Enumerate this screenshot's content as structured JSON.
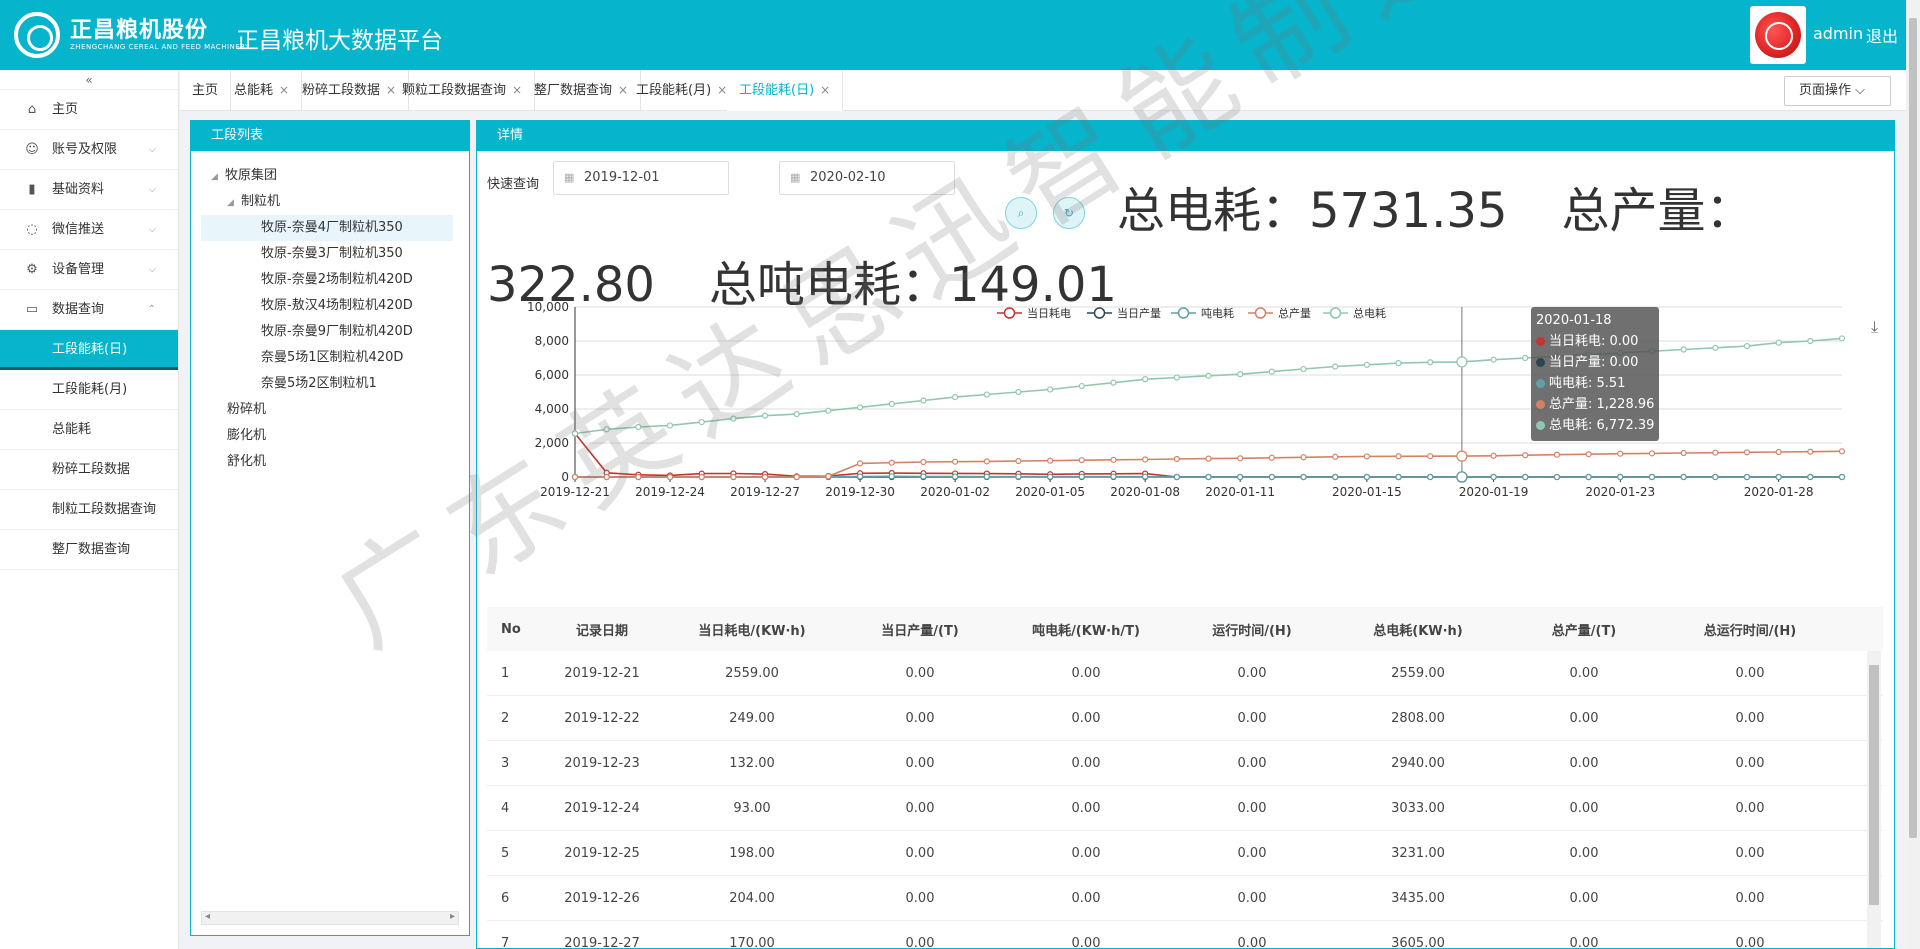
{
  "header": {
    "brand_cn": "正昌粮机股份",
    "brand_en": "ZHENGCHANG CEREAL AND FEED MACHINERY",
    "platform_title": "正昌粮机大数据平台",
    "user": "admin",
    "logout": "退出"
  },
  "sidebar": {
    "collapse": "«",
    "items": [
      {
        "label": "主页",
        "icon": "home-icon",
        "glyph": "⌂"
      },
      {
        "label": "账号及权限",
        "icon": "user-icon",
        "glyph": "☺",
        "chev": "⌵"
      },
      {
        "label": "基础资料",
        "icon": "bar-chart-icon",
        "glyph": "▮",
        "chev": "⌵"
      },
      {
        "label": "微信推送",
        "icon": "wechat-icon",
        "glyph": "◌",
        "chev": "⌵"
      },
      {
        "label": "设备管理",
        "icon": "chip-icon",
        "glyph": "⚙",
        "chev": "⌵"
      },
      {
        "label": "数据查询",
        "icon": "monitor-icon",
        "glyph": "▭",
        "chev": "⌃"
      }
    ],
    "sub_items": [
      "工段能耗(日)",
      "工段能耗(月)",
      "总能耗",
      "粉碎工段数据",
      "制粒工段数据查询",
      "整厂数据查询"
    ]
  },
  "tabs": [
    {
      "label": "主页",
      "closable": false
    },
    {
      "label": "总能耗",
      "closable": true
    },
    {
      "label": "粉碎工段数据",
      "closable": true
    },
    {
      "label": "颗粒工段数据查询",
      "closable": true
    },
    {
      "label": "整厂数据查询",
      "closable": true
    },
    {
      "label": "工段能耗(月)",
      "closable": true
    },
    {
      "label": "工段能耗(日)",
      "closable": true
    }
  ],
  "tab_close": "×",
  "page_ops": "页面操作 ⌵",
  "left_panel": {
    "title": "工段列表",
    "tree": [
      {
        "label": "牧原集团",
        "level": 0,
        "caret": "◢"
      },
      {
        "label": "制粒机",
        "level": 1,
        "caret": "◢"
      },
      {
        "label": "牧原-奈曼4厂制粒机350",
        "level": 2,
        "selected": true
      },
      {
        "label": "牧原-奈曼3厂制粒机350",
        "level": 2
      },
      {
        "label": "牧原-奈曼2场制粒机420D",
        "level": 2
      },
      {
        "label": "牧原-敖汉4场制粒机420D",
        "level": 2
      },
      {
        "label": "牧原-奈曼9厂制粒机420D",
        "level": 2
      },
      {
        "label": "奈曼5场1区制粒机420D",
        "level": 2
      },
      {
        "label": "奈曼5场2区制粒机1",
        "level": 2
      },
      {
        "label": "粉碎机",
        "level": 1
      },
      {
        "label": "膨化机",
        "level": 1
      },
      {
        "label": "舒化机",
        "level": 1
      }
    ],
    "scroll_left": "◂",
    "scroll_right": "▸"
  },
  "detail": {
    "title": "详情",
    "quick_query": "快速查询",
    "date_from": "2019-12-01",
    "date_to": "2020-02-10",
    "summary": {
      "power_label": "总电耗：",
      "power_value": "5731.35",
      "output_label": "总产量：",
      "output_value": "322.80",
      "per_ton_label": "总吨电耗：",
      "per_ton_value": "149.01"
    }
  },
  "tooltip": {
    "date": "2020-01-18",
    "rows": [
      {
        "text": "当日耗电: 0.00",
        "color": "#c23531"
      },
      {
        "text": "当日产量: 0.00",
        "color": "#2f4554"
      },
      {
        "text": "吨电耗: 5.51",
        "color": "#61a0a8"
      },
      {
        "text": "总产量: 1,228.96",
        "color": "#d48265"
      },
      {
        "text": "总电耗: 6,772.39",
        "color": "#91c7ae"
      }
    ]
  },
  "chart_data": {
    "type": "line",
    "x": [
      "2019-12-21",
      "2019-12-22",
      "2019-12-23",
      "2019-12-24",
      "2019-12-25",
      "2019-12-26",
      "2019-12-27",
      "2019-12-28",
      "2019-12-29",
      "2019-12-30",
      "2019-12-31",
      "2020-01-01",
      "2020-01-02",
      "2020-01-03",
      "2020-01-04",
      "2020-01-05",
      "2020-01-06",
      "2020-01-07",
      "2020-01-08",
      "2020-01-09",
      "2020-01-10",
      "2020-01-11",
      "2020-01-12",
      "2020-01-13",
      "2020-01-14",
      "2020-01-15",
      "2020-01-16",
      "2020-01-17",
      "2020-01-18",
      "2020-01-19",
      "2020-01-20",
      "2020-01-21",
      "2020-01-22",
      "2020-01-23",
      "2020-01-24",
      "2020-01-25",
      "2020-01-26",
      "2020-01-27",
      "2020-01-28",
      "2020-01-29",
      "2020-01-30"
    ],
    "x_ticks": [
      "2019-12-21",
      "2019-12-24",
      "2019-12-27",
      "2019-12-30",
      "2020-01-02",
      "2020-01-05",
      "2020-01-08",
      "2020-01-11",
      "2020-01-15",
      "2020-01-19",
      "2020-01-23",
      "2020-01-28"
    ],
    "series": [
      {
        "name": "当日耗电",
        "color": "#c23531",
        "values": [
          2559,
          249,
          132,
          93,
          198,
          204,
          170,
          40,
          60,
          220,
          230,
          220,
          210,
          200,
          190,
          160,
          180,
          190,
          200,
          0,
          0,
          0,
          0,
          0,
          0,
          0,
          0,
          0,
          0,
          0,
          0,
          0,
          0,
          0,
          0,
          0,
          0,
          0,
          0,
          0,
          0
        ]
      },
      {
        "name": "当日产量",
        "color": "#2f4554",
        "values": [
          0,
          0,
          0,
          0,
          0,
          0,
          0,
          0,
          0,
          0,
          0,
          0,
          0,
          0,
          0,
          0,
          0,
          0,
          0,
          0,
          0,
          0,
          0,
          0,
          0,
          0,
          0,
          0,
          0,
          0,
          0,
          0,
          0,
          0,
          0,
          0,
          0,
          0,
          0,
          0,
          0
        ]
      },
      {
        "name": "吨电耗",
        "color": "#61a0a8",
        "values": [
          0,
          0,
          0,
          0,
          0,
          0,
          0,
          0,
          20,
          30,
          40,
          30,
          25,
          20,
          20,
          15,
          20,
          20,
          20,
          0,
          0,
          0,
          0,
          0,
          0,
          0,
          0,
          0,
          5.51,
          0,
          0,
          0,
          0,
          0,
          0,
          0,
          0,
          0,
          0,
          0,
          0
        ]
      },
      {
        "name": "总产量",
        "color": "#d48265",
        "values": [
          0,
          0,
          0,
          0,
          0,
          0,
          0,
          0,
          40,
          800,
          840,
          880,
          900,
          920,
          940,
          960,
          990,
          1010,
          1030,
          1060,
          1080,
          1100,
          1130,
          1160,
          1190,
          1210,
          1220,
          1225,
          1228.96,
          1250,
          1280,
          1310,
          1340,
          1370,
          1390,
          1410,
          1430,
          1450,
          1470,
          1490,
          1510
        ]
      },
      {
        "name": "总电耗",
        "color": "#91c7ae",
        "values": [
          2559,
          2808,
          2940,
          3033,
          3231,
          3435,
          3605,
          3700,
          3900,
          4100,
          4300,
          4500,
          4700,
          4850,
          5000,
          5150,
          5350,
          5550,
          5750,
          5850,
          5950,
          6050,
          6200,
          6350,
          6500,
          6600,
          6700,
          6750,
          6772.39,
          6900,
          7000,
          7100,
          7200,
          7300,
          7400,
          7500,
          7600,
          7700,
          7900,
          8000,
          8150
        ]
      }
    ],
    "ylim": [
      0,
      10000
    ],
    "y_ticks": [
      "0",
      "2,000",
      "4,000",
      "6,000",
      "8,000",
      "10,000"
    ],
    "grid": true,
    "legend": "top-center"
  },
  "table": {
    "columns": [
      "No",
      "记录日期",
      "当日耗电/(KW·h)",
      "当日产量/(T)",
      "吨电耗/(KW·h/T)",
      "运行时间/(H)",
      "总电耗(KW·h)",
      "总产量/(T)",
      "总运行时间/(H)"
    ],
    "rows": [
      [
        "1",
        "2019-12-21",
        "2559.00",
        "0.00",
        "0.00",
        "0.00",
        "2559.00",
        "0.00",
        "0.00"
      ],
      [
        "2",
        "2019-12-22",
        "249.00",
        "0.00",
        "0.00",
        "0.00",
        "2808.00",
        "0.00",
        "0.00"
      ],
      [
        "3",
        "2019-12-23",
        "132.00",
        "0.00",
        "0.00",
        "0.00",
        "2940.00",
        "0.00",
        "0.00"
      ],
      [
        "4",
        "2019-12-24",
        "93.00",
        "0.00",
        "0.00",
        "0.00",
        "3033.00",
        "0.00",
        "0.00"
      ],
      [
        "5",
        "2019-12-25",
        "198.00",
        "0.00",
        "0.00",
        "0.00",
        "3231.00",
        "0.00",
        "0.00"
      ],
      [
        "6",
        "2019-12-26",
        "204.00",
        "0.00",
        "0.00",
        "0.00",
        "3435.00",
        "0.00",
        "0.00"
      ],
      [
        "7",
        "2019-12-27",
        "170.00",
        "0.00",
        "0.00",
        "0.00",
        "3605.00",
        "0.00",
        "0.00"
      ]
    ]
  },
  "watermark": "广东英达思迅智能制造"
}
